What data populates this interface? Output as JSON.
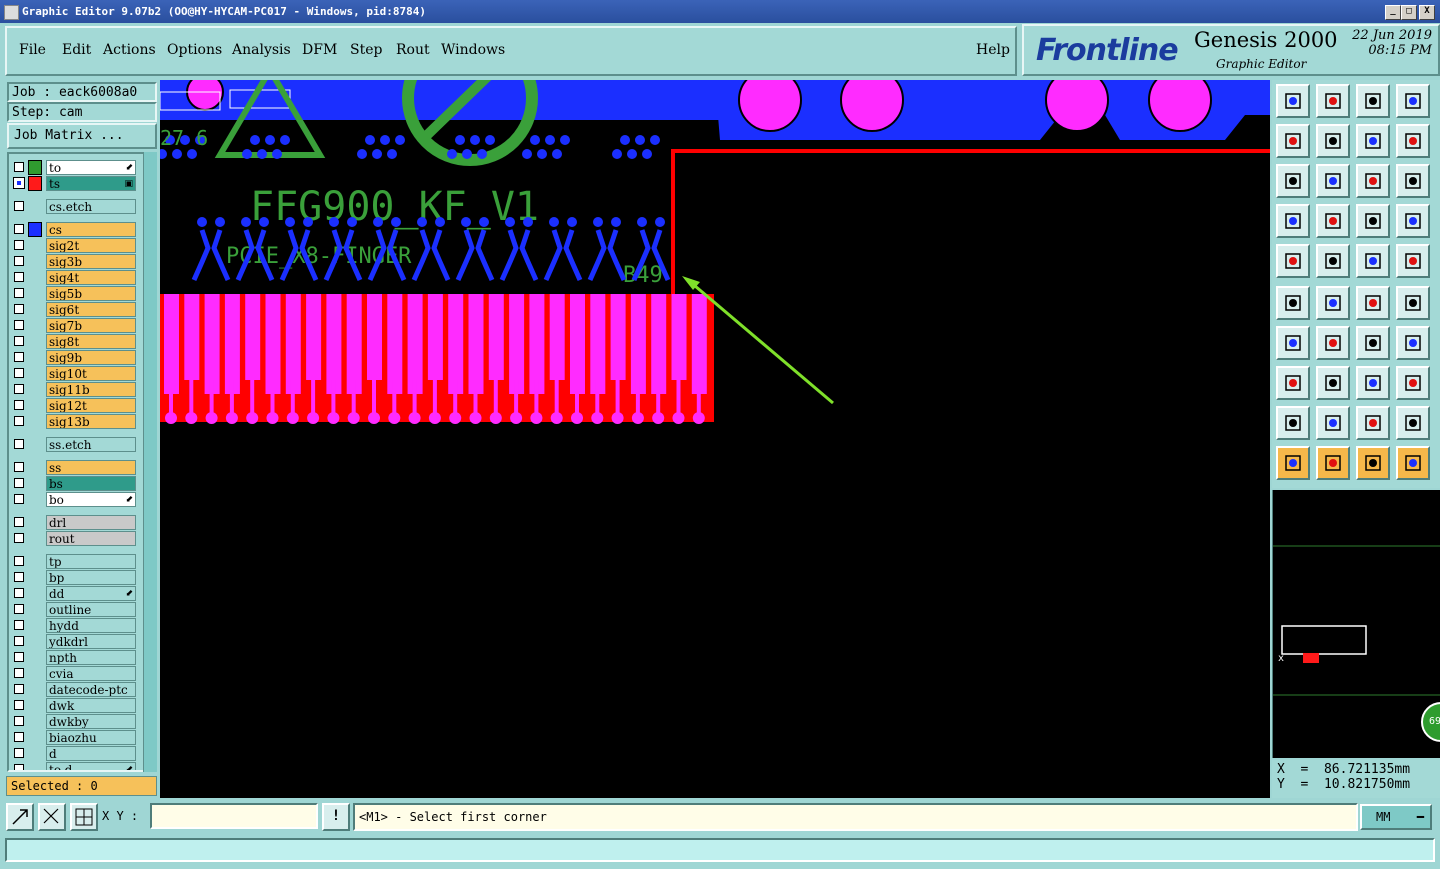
{
  "window": {
    "title": "Graphic Editor 9.07b2  (OO@HY-HYCAM-PC017 - Windows, pid:8784)",
    "controls": [
      "_",
      "□",
      "X"
    ]
  },
  "menu": {
    "items": [
      "File",
      "Edit",
      "Actions",
      "Options",
      "Analysis",
      "DFM",
      "Step",
      "Rout",
      "Windows"
    ],
    "help": "Help"
  },
  "logo": {
    "brand": "Frontline",
    "product": "Genesis 2000",
    "subtitle": "Graphic Editor",
    "date": "22 Jun 2019",
    "time": "08:15 PM"
  },
  "job": {
    "job_text": "Job : eack6008a0",
    "step_text": "Step: cam",
    "matrix_button": "Job Matrix ..."
  },
  "layers": [
    {
      "name": "to",
      "swatch": "#2f9b2f",
      "bg": "#ffffff",
      "marker": "⬋",
      "checked": false
    },
    {
      "name": "ts",
      "swatch": "#ff1a1a",
      "bg": "#2f9b8a",
      "marker": "▣",
      "checked": true
    },
    {
      "name": "cs.etch",
      "swatch": "",
      "bg": "#a3d9d6",
      "marker": "",
      "checked": false
    },
    {
      "name": "cs",
      "swatch": "#1b2fff",
      "bg": "#f6c15a",
      "marker": "",
      "checked": false
    },
    {
      "name": "sig2t",
      "swatch": "",
      "bg": "#f6c15a",
      "marker": "",
      "checked": false
    },
    {
      "name": "sig3b",
      "swatch": "",
      "bg": "#f6c15a",
      "marker": "",
      "checked": false
    },
    {
      "name": "sig4t",
      "swatch": "",
      "bg": "#f6c15a",
      "marker": "",
      "checked": false
    },
    {
      "name": "sig5b",
      "swatch": "",
      "bg": "#f6c15a",
      "marker": "",
      "checked": false
    },
    {
      "name": "sig6t",
      "swatch": "",
      "bg": "#f6c15a",
      "marker": "",
      "checked": false
    },
    {
      "name": "sig7b",
      "swatch": "",
      "bg": "#f6c15a",
      "marker": "",
      "checked": false
    },
    {
      "name": "sig8t",
      "swatch": "",
      "bg": "#f6c15a",
      "marker": "",
      "checked": false
    },
    {
      "name": "sig9b",
      "swatch": "",
      "bg": "#f6c15a",
      "marker": "",
      "checked": false
    },
    {
      "name": "sig10t",
      "swatch": "",
      "bg": "#f6c15a",
      "marker": "",
      "checked": false
    },
    {
      "name": "sig11b",
      "swatch": "",
      "bg": "#f6c15a",
      "marker": "",
      "checked": false
    },
    {
      "name": "sig12t",
      "swatch": "",
      "bg": "#f6c15a",
      "marker": "",
      "checked": false
    },
    {
      "name": "sig13b",
      "swatch": "",
      "bg": "#f6c15a",
      "marker": "",
      "checked": false
    },
    {
      "name": "ss.etch",
      "swatch": "",
      "bg": "#a3d9d6",
      "marker": "",
      "checked": false
    },
    {
      "name": "ss",
      "swatch": "",
      "bg": "#f6c15a",
      "marker": "",
      "checked": false
    },
    {
      "name": "bs",
      "swatch": "",
      "bg": "#2f9b8a",
      "marker": "",
      "checked": false
    },
    {
      "name": "bo",
      "swatch": "",
      "bg": "#ffffff",
      "marker": "⬋",
      "checked": false
    },
    {
      "name": "drl",
      "swatch": "",
      "bg": "#c9c9c9",
      "marker": "",
      "checked": false
    },
    {
      "name": "rout",
      "swatch": "",
      "bg": "#c9c9c9",
      "marker": "",
      "checked": false
    },
    {
      "name": "tp",
      "swatch": "",
      "bg": "#a3d9d6",
      "marker": "",
      "checked": false
    },
    {
      "name": "bp",
      "swatch": "",
      "bg": "#a3d9d6",
      "marker": "",
      "checked": false
    },
    {
      "name": "dd",
      "swatch": "",
      "bg": "#a3d9d6",
      "marker": "⬋",
      "checked": false
    },
    {
      "name": "outline",
      "swatch": "",
      "bg": "#a3d9d6",
      "marker": "",
      "checked": false
    },
    {
      "name": "hydd",
      "swatch": "",
      "bg": "#a3d9d6",
      "marker": "",
      "checked": false
    },
    {
      "name": "ydkdrl",
      "swatch": "",
      "bg": "#a3d9d6",
      "marker": "",
      "checked": false
    },
    {
      "name": "npth",
      "swatch": "",
      "bg": "#a3d9d6",
      "marker": "",
      "checked": false
    },
    {
      "name": "cvia",
      "swatch": "",
      "bg": "#a3d9d6",
      "marker": "",
      "checked": false
    },
    {
      "name": "datecode-ptc",
      "swatch": "",
      "bg": "#a3d9d6",
      "marker": "",
      "checked": false
    },
    {
      "name": "dwk",
      "swatch": "",
      "bg": "#a3d9d6",
      "marker": "",
      "checked": false
    },
    {
      "name": "dwkby",
      "swatch": "",
      "bg": "#a3d9d6",
      "marker": "",
      "checked": false
    },
    {
      "name": "biaozhu",
      "swatch": "",
      "bg": "#a3d9d6",
      "marker": "",
      "checked": false
    },
    {
      "name": "d",
      "swatch": "",
      "bg": "#a3d9d6",
      "marker": "",
      "checked": false
    },
    {
      "name": "to.d",
      "swatch": "",
      "bg": "#a3d9d6",
      "marker": "⬋",
      "checked": false
    }
  ],
  "selected": "Selected : 0",
  "canvas": {
    "board_text": "FFG900_KF_V1",
    "finger_text": "PCIE_X8-FINGER",
    "pin_label": "B49",
    "corner_text": "27  6",
    "colors": {
      "blue": "#1b2fff",
      "pink": "#ff2bff",
      "red": "#ff0000",
      "green": "#3aa03a",
      "arrow": "#7fe02a"
    }
  },
  "coords": {
    "x": "X  =  86.721135mm",
    "y": "Y  =  10.821750mm"
  },
  "bottom": {
    "xy_label": "X Y :",
    "xy_value": "",
    "message": "<M1> - Select first corner",
    "units": "MM",
    "bang": "!"
  },
  "badge": "69"
}
